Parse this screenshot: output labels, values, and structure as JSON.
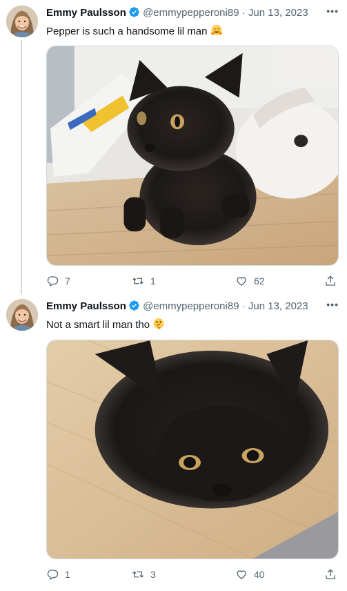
{
  "tweets": [
    {
      "author_name": "Emmy Paulsson",
      "handle": "@emmypepperoni89",
      "separator": "·",
      "date": "Jun 13, 2023",
      "text": "Pepper is such a handsome lil man",
      "emoji": "hugging-face",
      "more": "•••",
      "replies": "7",
      "retweets": "1",
      "likes": "62"
    },
    {
      "author_name": "Emmy Paulsson",
      "handle": "@emmypepperoni89",
      "separator": "·",
      "date": "Jun 13, 2023",
      "text": "Not a smart lil man tho",
      "emoji": "thinking-face",
      "more": "•••",
      "replies": "1",
      "retweets": "3",
      "likes": "40"
    }
  ],
  "colors": {
    "verified": "#1d9bf0",
    "secondary_text": "#536471",
    "thread_line": "#cfd9de"
  }
}
